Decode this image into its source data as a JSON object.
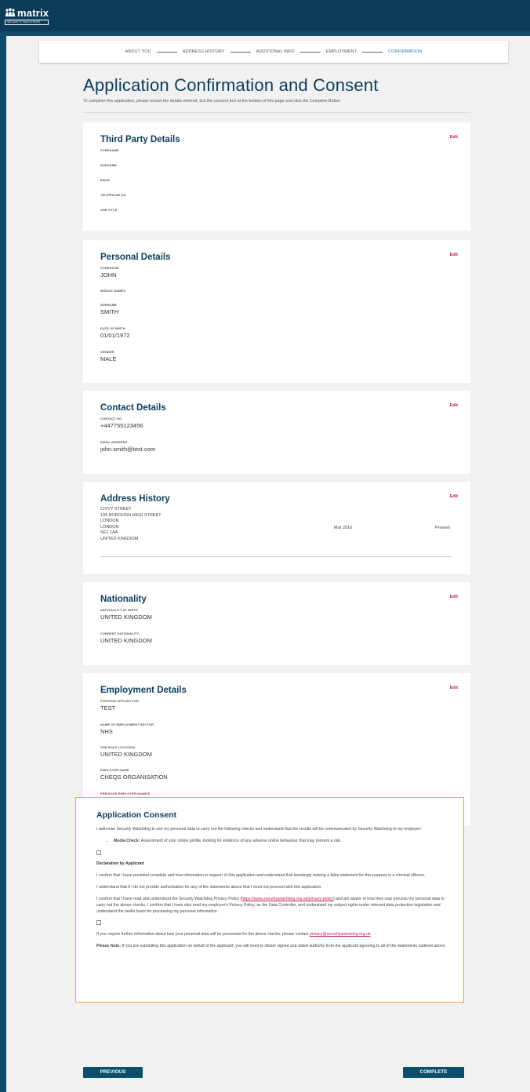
{
  "brand": {
    "name": "matrix",
    "sub": "SECURITY WATCHDOG"
  },
  "stepper": [
    {
      "label": "ABOUT YOU",
      "active": false
    },
    {
      "label": "ADDRESS HISTORY",
      "active": false
    },
    {
      "label": "ADDITIONAL INFO",
      "active": false
    },
    {
      "label": "EMPLOYMENT",
      "active": false
    },
    {
      "label": "CONFIRMATION",
      "active": true
    }
  ],
  "page": {
    "title": "Application Confirmation and Consent",
    "intro": "To complete this application, please review the details entered, tick the consent box at the bottom of this page and click the Complete Button"
  },
  "edit_label": "Edit",
  "third_party": {
    "title": "Third Party Details",
    "fields": [
      {
        "label": "FORENAME",
        "value": ""
      },
      {
        "label": "SURNAME",
        "value": ""
      },
      {
        "label": "EMAIL",
        "value": ""
      },
      {
        "label": "TELEPHONE NO",
        "value": ""
      },
      {
        "label": "JOB TITLE",
        "value": ""
      }
    ]
  },
  "personal": {
    "title": "Personal Details",
    "fields": [
      {
        "label": "FORENAME",
        "value": "JOHN"
      },
      {
        "label": "MIDDLE NAMES",
        "value": ""
      },
      {
        "label": "SURNAME",
        "value": "SMITH"
      },
      {
        "label": "DATE OF BIRTH",
        "value": "01/01/1972"
      },
      {
        "label": "GENDER",
        "value": "MALE"
      }
    ]
  },
  "contact": {
    "title": "Contact Details",
    "fields": [
      {
        "label": "CONTACT NO",
        "value": "+447755123456"
      },
      {
        "label": "EMAIL ADDRESS",
        "value": "john.smith@test.com"
      }
    ]
  },
  "address": {
    "title": "Address History",
    "lines": [
      "CIVVY STREET",
      "199 BOROUGH HIGH STREET",
      "LONDON",
      "LONDON",
      "SE1 1AA",
      "UNITED KINGDOM"
    ],
    "from": "Mar 2016",
    "to": "Present"
  },
  "nationality": {
    "title": "Nationality",
    "fields": [
      {
        "label": "NATIONALITY AT BIRTH",
        "value": "UNITED KINGDOM"
      },
      {
        "label": "CURRENT NATIONALITY",
        "value": "UNITED KINGDOM"
      }
    ]
  },
  "employment": {
    "title": "Employment Details",
    "fields": [
      {
        "label": "POSITION APPLIED FOR",
        "value": "TEST"
      },
      {
        "label": "NAME OF EMPLOYMENT SECTOR",
        "value": "NHS"
      },
      {
        "label": "JOB ROLE LOCATION",
        "value": "UNITED KINGDOM"
      },
      {
        "label": "EMPLOYER NAME",
        "value": "CHEQS ORGANISATION"
      },
      {
        "label": "PREVIOUS EMPLOYER NAME/S",
        "value": ""
      }
    ]
  },
  "consent": {
    "title": "Application Consent",
    "authorise": "I authorise Security Watchdog to use my personal data to carry out the following checks and understand that the results will be communicated by Security Watchdog to my employer:",
    "media_check_label": "Media Check:",
    "media_check_text": " Assessment of your online profile, looking for evidence of any adverse online behaviour that may present a risk.",
    "declaration_title": "Declaration by Applicant",
    "decl_1": "I confirm that I have provided complete and true information in support of this application and understand that knowingly making a false statement for this purpose is a criminal offence.",
    "decl_2": "I understand that if I do not provide authorisation for any of the statements above that I must not proceed with this application.",
    "privacy_a": "I confirm that I have read and understood the Security Watchdog Privacy Policy (",
    "privacy_url": "https://www.securitywatchdog.org.uk/privacy-policy",
    "privacy_b": ") and am aware of how they may process my personal data to carry out the above checks. I confirm that I have also read my employer's Privacy Policy, as the Data Controller, and understand my subject rights under relevant data protection legislation and understand the lawful basis for processing my personal information.",
    "further_a": "If you require further information about how your personal data will be processed for the above checks, please contact ",
    "further_email": "privacy@securitywatchdog.org.uk",
    "further_b": ".",
    "note_label": "Please Note:",
    "note_text": " If you are submitting this application on behalf of the applicant, you will need to obtain signed and dated authority from the applicant agreeing to all of the statements outlined above."
  },
  "buttons": {
    "previous": "PREVIOUS",
    "complete": "COMPLETE"
  }
}
